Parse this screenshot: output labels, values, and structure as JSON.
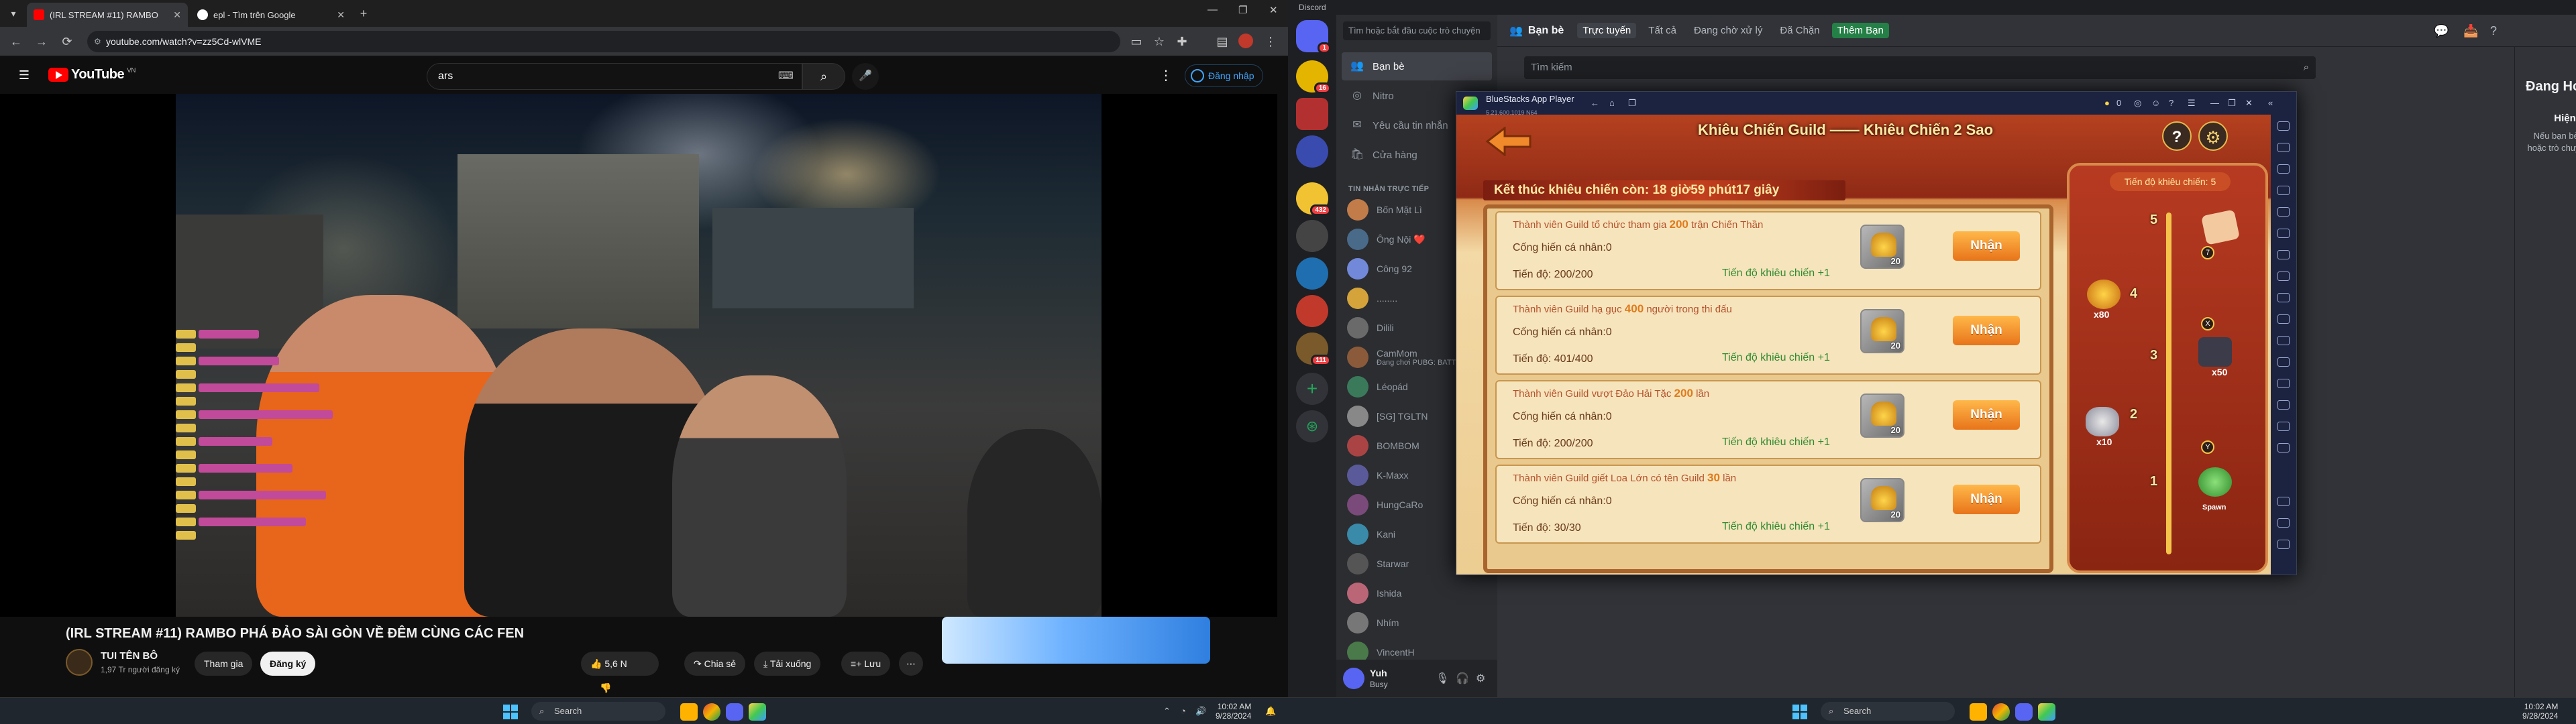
{
  "chrome": {
    "tabs": [
      {
        "title": "(IRL STREAM #11) RAMBO"
      },
      {
        "title": "epl - Tìm trên Google"
      }
    ],
    "url": "youtube.com/watch?v=zz5Cd-wlVME"
  },
  "youtube": {
    "logo_text": "YouTube",
    "country_code": "VN",
    "search_value": "ars",
    "signin_label": "Đăng nhập",
    "video_title": "(IRL STREAM #11) RAMBO PHÁ ĐẢO SÀI GÒN VỀ ĐÊM CÙNG CÁC FEN",
    "channel_name": "TUI TÊN BÔ",
    "channel_subs": "1,97 Tr người đăng ký",
    "join_label": "Tham gia",
    "subscribe_label": "Đăng ký",
    "like_count": "5,6 N",
    "share_label": "Chia sẻ",
    "download_label": "Tải xuống",
    "save_label": "Lưu"
  },
  "taskbar_left": {
    "search_label": "Search",
    "time": "10:02 AM",
    "date": "9/28/2024"
  },
  "taskbar_right": {
    "search_label": "Search",
    "time": "10:02 AM",
    "date": "9/28/2024"
  },
  "discord": {
    "app_title": "Discord",
    "dm_search": "Tìm hoặc bắt đầu cuộc trò chuyện",
    "nav": [
      {
        "label": "Bạn bè",
        "icon": "friends-icon"
      },
      {
        "label": "Nitro",
        "icon": "nitro-icon"
      },
      {
        "label": "Yêu cầu tin nhắn",
        "icon": "message-request-icon"
      },
      {
        "label": "Cửa hàng",
        "icon": "shop-icon"
      }
    ],
    "dm_header": "TIN NHẮN TRỰC TIẾP",
    "dms": [
      {
        "name": "Bốn Mặt Lì",
        "color": "#c27c4a"
      },
      {
        "name": "Ông Nội ❤️",
        "color": "#4a6a8a"
      },
      {
        "name": "Công 92",
        "color": "#7289da"
      },
      {
        "name": "........",
        "color": "#d4a43a"
      },
      {
        "name": "Dilili",
        "color": "#6a6a6a"
      },
      {
        "name": "CamMom",
        "sub": "Đang chơi PUBG: BATT",
        "color": "#8a5a3a"
      },
      {
        "name": "Léopád",
        "color": "#3a7a5a"
      },
      {
        "name": "[SG] TGLTN",
        "color": "#888"
      },
      {
        "name": "BOMBOM",
        "color": "#aa4444"
      },
      {
        "name": "K-Maxx",
        "color": "#5a5a9a"
      },
      {
        "name": "HungCaRo",
        "color": "#7a4a7a"
      },
      {
        "name": "Kani",
        "color": "#3a8aaa"
      },
      {
        "name": "Starwar",
        "color": "#555"
      },
      {
        "name": "Ishida",
        "color": "#bb6677"
      },
      {
        "name": "Nhím",
        "color": "#777"
      },
      {
        "name": "VincentH",
        "color": "#4a7a4a"
      }
    ],
    "user": {
      "name": "Yuh",
      "status": "Busy"
    },
    "friends_title": "Bạn bè",
    "tabs": [
      "Trực tuyến",
      "Tất cả",
      "Đang chờ xử lý",
      "Đã Chặn"
    ],
    "add_friend": "Thêm Bạn",
    "friends_search": "Tìm kiếm",
    "active_now_title": "Đang Hoạt Động",
    "active_now_heading": "Hiện tại không có cập nhật mới nào cả...",
    "active_now_body": "Nếu bạn bè của bạn có hoạt động mới, ví dụ như chơi game hoặc trò chuyện thoại, chúng tôi sẽ hiển thị hoạt động đó ở đây!",
    "server_badges": [
      "1",
      "16",
      "432",
      "111"
    ]
  },
  "bluestacks": {
    "title": "BlueStacks App Player",
    "version": "5.21.600.1019 N64",
    "coin_count": "0"
  },
  "game": {
    "title": "Khiêu Chiến Guild —— Khiêu Chiến 2 Sao",
    "timer": "Kết thúc khiêu chiến còn: 18 giờ59 phút17 giây",
    "road_header": "Tiến độ khiêu chiến: 5",
    "quests": [
      {
        "title_pre": "Thành viên Guild tổ chức tham gia ",
        "title_num": "200",
        "title_post": " trận Chiến Thần",
        "contrib": "Cống hiến cá nhân:0",
        "progress": "Tiến độ: 200/200",
        "reward_label": "Tiến độ khiêu chiến +1",
        "reward_count": "20",
        "button": "Nhận"
      },
      {
        "title_pre": "Thành viên Guild hạ gục ",
        "title_num": "400",
        "title_post": " người trong thi đấu",
        "contrib": "Cống hiến cá nhân:0",
        "progress": "Tiến độ: 401/400",
        "reward_label": "Tiến độ khiêu chiến +1",
        "reward_count": "20",
        "button": "Nhận"
      },
      {
        "title_pre": "Thành viên Guild vượt Đảo Hải Tặc ",
        "title_num": "200",
        "title_post": " lần",
        "contrib": "Cống hiến cá nhân:0",
        "progress": "Tiến độ: 200/200",
        "reward_label": "Tiến độ khiêu chiến +1",
        "reward_count": "20",
        "button": "Nhận"
      },
      {
        "title_pre": "Thành viên Guild giết Loa Lớn có tên Guild ",
        "title_num": "30",
        "title_post": " lần",
        "contrib": "Cống hiến cá nhân:0",
        "progress": "Tiến độ: 30/30",
        "reward_label": "Tiến độ khiêu chiến +1",
        "reward_count": "20",
        "button": "Nhận"
      }
    ],
    "road_levels": [
      "5",
      "4",
      "3",
      "2",
      "1"
    ],
    "road_counts": [
      "x80",
      "x50",
      "x10"
    ],
    "spawn_label": "Spawn"
  }
}
